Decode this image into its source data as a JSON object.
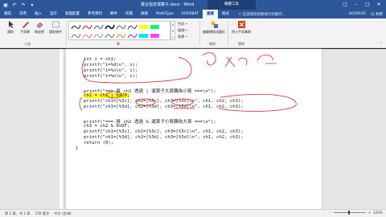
{
  "window": {
    "title": "複合指定運算子.docx - Word",
    "context_tab": "繪圖工具"
  },
  "tabs": [
    {
      "label": "檔案"
    },
    {
      "label": "常用"
    },
    {
      "label": "插入"
    },
    {
      "label": "設計"
    },
    {
      "label": "版面配置"
    },
    {
      "label": "參考資料"
    },
    {
      "label": "郵件"
    },
    {
      "label": "校閱"
    },
    {
      "label": "檢視"
    },
    {
      "label": "MathType"
    },
    {
      "label": "ACROBAT"
    },
    {
      "label": "畫圖"
    },
    {
      "label": "格式"
    }
  ],
  "tell_me": "告訴我您想要執行的動作...",
  "user": {
    "name": "st150102",
    "share": "共用"
  },
  "ribbon": {
    "tools": [
      {
        "label": "選取",
        "icon": "cursor-icon"
      },
      {
        "label": "手寫筆",
        "icon": "pen-icon"
      },
      {
        "label": "橡皮擦",
        "icon": "eraser-icon"
      },
      {
        "label": "選取物件",
        "icon": "select-objects-icon"
      }
    ],
    "tools_group": "工具",
    "pens_group": "筆",
    "side_items": [
      "色彩 •",
      "粗細 •",
      "效果 •"
    ],
    "convert_label": "繪圖轉換成圖形",
    "stop_label": "停止手寫筆跡",
    "convert_group": "轉換",
    "close_group": "關閉"
  },
  "code_lines": [
    "int i = ch1;",
    "printf(\"i=%d\\n\", i);",
    "printf(\"i=%x\\n\", i);",
    "printf(\"i=%o\\n\", i);",
    "",
    "printf(\"=== 將 ch1 透過 | 運算子大寫轉為小寫 ===\\n\");",
    "ch2 = ch1 | 0x20;",
    "printf(\"ch1=[%3c], ch2=[%3c], ch3=[%3c]\\n\", ch1, ch2, ch3);",
    "printf(\"ch1=[%3d], ch2=[%3d], ch3=[%3d]\\n\", ch1, ch2, ch3);",
    "",
    "printf(\"=== 將 ch2 透過 & 運算子小寫轉為大寫 ===\\n\");",
    "ch3 = ch2 & 0xDF;",
    "printf(\"ch1=[%3c], ch2=[%3c], ch3=[%3c]\\n\", ch1, ch2, ch3);",
    "printf(\"ch1=[%3d], ch2=[%3d], ch3=[%3d]\\n\", ch1, ch2, ch3);",
    "return (0);",
    "}"
  ],
  "status": {
    "page": "第 2 頁，共 2 頁",
    "words": "156 個字",
    "lang": "中文 (台灣)",
    "zoom": "120%"
  },
  "colors": {
    "title_bar": "#2b579a",
    "highlight": "#ffff00",
    "ink_red": "#d81e1e"
  }
}
